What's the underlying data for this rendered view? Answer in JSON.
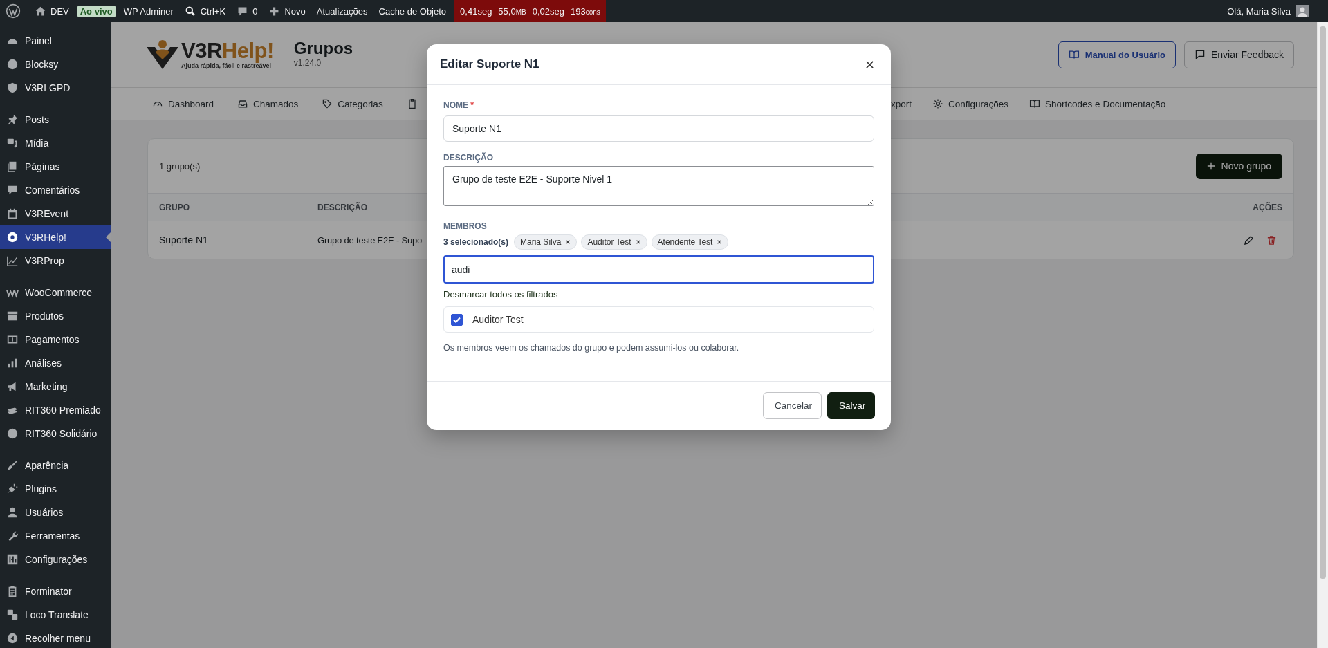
{
  "admin_bar": {
    "site": "DEV",
    "badge": "Ao vivo",
    "items": [
      {
        "label": "WP Adminer",
        "kind": "text"
      },
      {
        "label": "Ctrl+K",
        "kind": "search"
      },
      {
        "label": "0",
        "kind": "comments"
      },
      {
        "label": "Novo",
        "kind": "new"
      },
      {
        "label": "Atualizações",
        "kind": "text"
      },
      {
        "label": "Cache de Objeto",
        "kind": "text"
      }
    ],
    "perf": [
      {
        "value": "0,41seg"
      },
      {
        "value": "55,0",
        "unit": "MB"
      },
      {
        "value": "0,02seg"
      },
      {
        "value": "193",
        "unit": "cons"
      }
    ],
    "greeting": "Olá, Maria Silva"
  },
  "sidebar": {
    "groups": [
      {
        "items": [
          {
            "label": "Painel",
            "selected": false
          },
          {
            "label": "Blocksy",
            "selected": false
          },
          {
            "label": "V3RLGPD",
            "selected": false
          }
        ]
      },
      {
        "items": [
          {
            "label": "Posts",
            "selected": false
          },
          {
            "label": "Mídia",
            "selected": false
          },
          {
            "label": "Páginas",
            "selected": false
          },
          {
            "label": "Comentários",
            "selected": false
          },
          {
            "label": "V3REvent",
            "selected": false
          },
          {
            "label": "V3RHelp!",
            "selected": true
          },
          {
            "label": "V3RProp",
            "selected": false
          }
        ]
      },
      {
        "items": [
          {
            "label": "WooCommerce",
            "selected": false
          },
          {
            "label": "Produtos",
            "selected": false
          },
          {
            "label": "Pagamentos",
            "selected": false
          },
          {
            "label": "Análises",
            "selected": false
          },
          {
            "label": "Marketing",
            "selected": false
          },
          {
            "label": "RIT360 Premiado",
            "selected": false
          },
          {
            "label": "RIT360 Solidário",
            "selected": false
          }
        ]
      },
      {
        "items": [
          {
            "label": "Aparência",
            "selected": false
          },
          {
            "label": "Plugins",
            "selected": false
          },
          {
            "label": "Usuários",
            "selected": false
          },
          {
            "label": "Ferramentas",
            "selected": false
          },
          {
            "label": "Configurações",
            "selected": false
          }
        ]
      },
      {
        "items": [
          {
            "label": "Forminator",
            "selected": false
          },
          {
            "label": "Loco Translate",
            "selected": false
          },
          {
            "label": "Recolher menu",
            "selected": false
          }
        ]
      }
    ]
  },
  "header": {
    "logo": {
      "brand_a": "V3R",
      "brand_b": "Help!",
      "tagline": "Ajuda rápida, fácil e rastreável"
    },
    "title": "Grupos",
    "version": "v1.24.0",
    "buttons": [
      {
        "label": "Manual do Usuário",
        "kind": "primary"
      },
      {
        "label": "Enviar Feedback",
        "kind": "default"
      }
    ]
  },
  "nav": {
    "tabs": [
      {
        "label": "Dashboard"
      },
      {
        "label": "Chamados"
      },
      {
        "label": "Categorias"
      },
      {
        "label": "xport"
      },
      {
        "label": "Configurações"
      },
      {
        "label": "Shortcodes e Documentação"
      }
    ]
  },
  "card": {
    "count": "1 grupo(s)",
    "new_button": "Novo grupo",
    "columns": [
      "GRUPO",
      "DESCRIÇÃO",
      "AÇÕES"
    ],
    "rows": [
      {
        "grupo": "Suporte N1",
        "descricao": "Grupo de teste E2E - Supo"
      }
    ]
  },
  "modal": {
    "title": "Editar Suporte N1",
    "name_label": "NOME",
    "required_mark": "*",
    "name_value": "Suporte N1",
    "desc_label": "DESCRIÇÃO",
    "desc_value": "Grupo de teste E2E - Suporte Nivel 1",
    "members_label": "MEMBROS",
    "selected_count": "3 selecionado(s)",
    "chips": [
      "Maria Silva",
      "Auditor Test",
      "Atendente Test"
    ],
    "search_value": "audi",
    "clear_link": "Desmarcar todos os filtrados",
    "options": [
      {
        "label": "Auditor Test",
        "checked": true
      }
    ],
    "help": "Os membros veem os chamados do grupo e podem assumi-los ou colaborar.",
    "buttons": [
      {
        "label": "Cancelar",
        "kind": "secondary"
      },
      {
        "label": "Salvar",
        "kind": "primary"
      }
    ]
  }
}
